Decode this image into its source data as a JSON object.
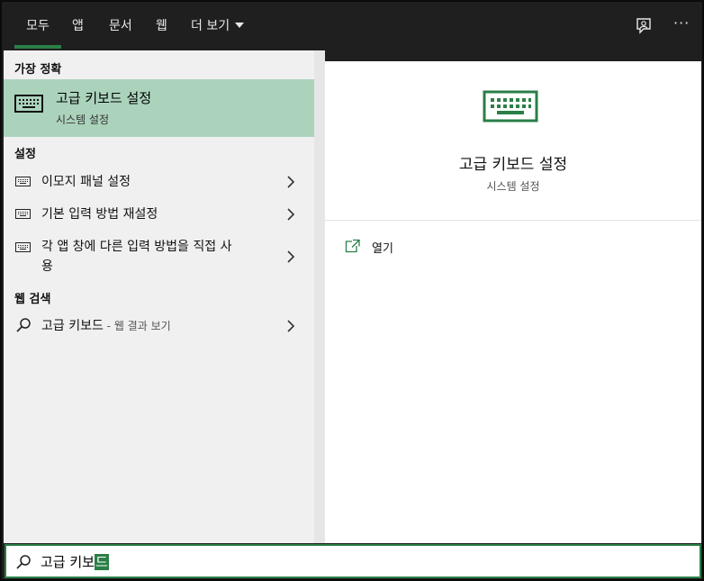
{
  "tabs": [
    {
      "label": "모두",
      "active": true
    },
    {
      "label": "앱"
    },
    {
      "label": "문서"
    },
    {
      "label": "웹"
    },
    {
      "label": "더 보기"
    }
  ],
  "left": {
    "best_match_heading": "가장 정확",
    "best_match": {
      "title": "고급 키보드 설정",
      "subtitle": "시스템 설정",
      "icon": "keyboard-icon"
    },
    "settings_heading": "설정",
    "settings_items": [
      {
        "label": "이모지 패널 설정",
        "icon": "keyboard-icon"
      },
      {
        "label": "기본 입력 방법 재설정",
        "icon": "keyboard-icon"
      },
      {
        "label_line1": "각 앱 창에 다른 입력 방법을 직접 사",
        "label_line2": "용",
        "icon": "keyboard-icon"
      }
    ],
    "web_heading": "웹 검색",
    "web_item": {
      "query": "고급 키보드",
      "hint": " - 웹 결과 보기",
      "icon": "search-icon"
    }
  },
  "right": {
    "title": "고급 키보드 설정",
    "subtitle": "시스템 설정",
    "actions": [
      {
        "label": "열기",
        "icon": "open-icon"
      }
    ]
  },
  "search": {
    "typed": "고급 키보",
    "composing": "드"
  },
  "colors": {
    "accent": "#2a7f47",
    "selected_bg": "#abd3bc",
    "titlebar": "#1f1f1f"
  }
}
